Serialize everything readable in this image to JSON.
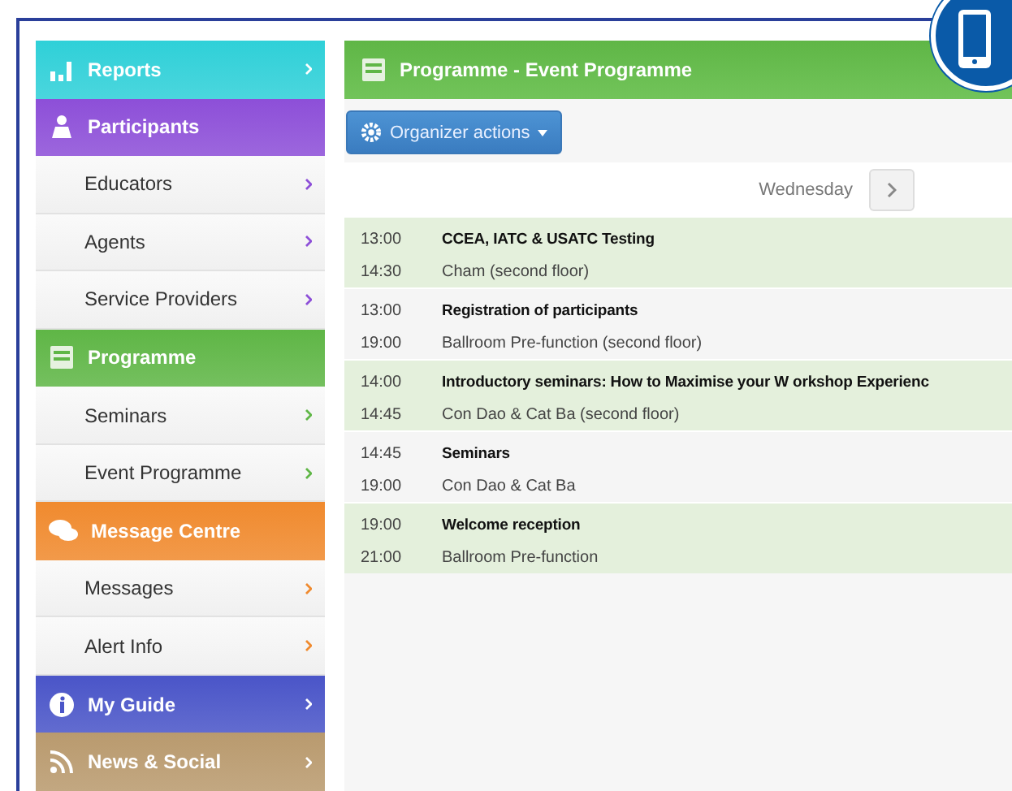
{
  "sidebar": [
    {
      "label": "Reports",
      "color": "#2fd0d8",
      "expanded": false
    },
    {
      "label": "Participants",
      "color": "#8d4fd8",
      "expanded": true,
      "children": [
        {
          "label": "Educators"
        },
        {
          "label": "Agents"
        },
        {
          "label": "Service Providers"
        }
      ]
    },
    {
      "label": "Programme",
      "color": "#5fb646",
      "expanded": true,
      "children": [
        {
          "label": "Seminars"
        },
        {
          "label": "Event Programme"
        }
      ]
    },
    {
      "label": "Message Centre",
      "color": "#f08a2e",
      "expanded": true,
      "children": [
        {
          "label": "Messages"
        },
        {
          "label": "Alert Info"
        }
      ]
    },
    {
      "label": "My Guide",
      "color": "#4a55c8",
      "expanded": false
    },
    {
      "label": "News & Social",
      "color": "#b99a6e",
      "expanded": false
    }
  ],
  "main": {
    "title": "Programme - Event Programme",
    "action_button": "Organizer actions",
    "day": "Wednesday",
    "events": [
      {
        "start": "13:00",
        "end": "14:30",
        "title": "CCEA, IATC & USATC Testing",
        "place": "Cham (second floor)"
      },
      {
        "start": "13:00",
        "end": "19:00",
        "title": "Registration of participants",
        "place": "Ballroom Pre-function (second floor)"
      },
      {
        "start": "14:00",
        "end": "14:45",
        "title": "Introductory seminars: How to Maximise your W orkshop Experienc",
        "place": "Con Dao & Cat Ba (second floor)"
      },
      {
        "start": "14:45",
        "end": "19:00",
        "title": "Seminars",
        "place": "Con Dao & Cat Ba"
      },
      {
        "start": "19:00",
        "end": "21:00",
        "title": "Welcome reception",
        "place": "Ballroom Pre-function"
      }
    ]
  }
}
